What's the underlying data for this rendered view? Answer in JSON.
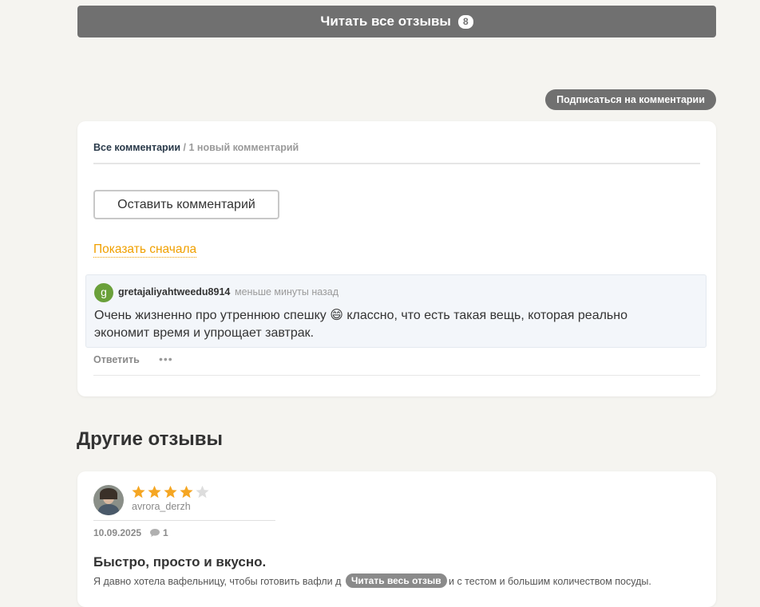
{
  "read_all_reviews": {
    "label": "Читать все отзывы",
    "count": "8"
  },
  "subscribe_label": "Подписаться на комментарии",
  "comments": {
    "tab_all": "Все комментарии",
    "tab_sep": " / ",
    "tab_new": "1 новый комментарий",
    "leave_comment_label": "Оставить комментарий",
    "show_first_label": "Показать сначала",
    "items": [
      {
        "avatar_letter": "g",
        "avatar_color": "#6aa03a",
        "author": "gretajaliyahtweedu8914",
        "time": "меньше минуты назад",
        "text": "Очень жизненно про утреннюю спешку 😄 классно, что есть такая вещь, которая реально экономит время и упрощает завтрак.",
        "reply_label": "Ответить",
        "more_label": "•••"
      }
    ]
  },
  "other_reviews": {
    "heading": "Другие отзывы",
    "items": [
      {
        "user": "avrora_derzh",
        "rating": 4,
        "max_rating": 5,
        "date": "10.09.2025",
        "comment_count": "1",
        "title": "Быстро, просто и вкусно.",
        "text_before": "Я давно хотела вафельницу, чтобы готовить вафли д",
        "text_after": "и с тестом и большим количеством посуды.",
        "read_full_label": "Читать весь отзыв"
      }
    ]
  },
  "colors": {
    "accent_orange": "#f0a000",
    "star_filled": "#f5a623",
    "star_empty": "#dddddd",
    "button_gray": "#707070"
  }
}
